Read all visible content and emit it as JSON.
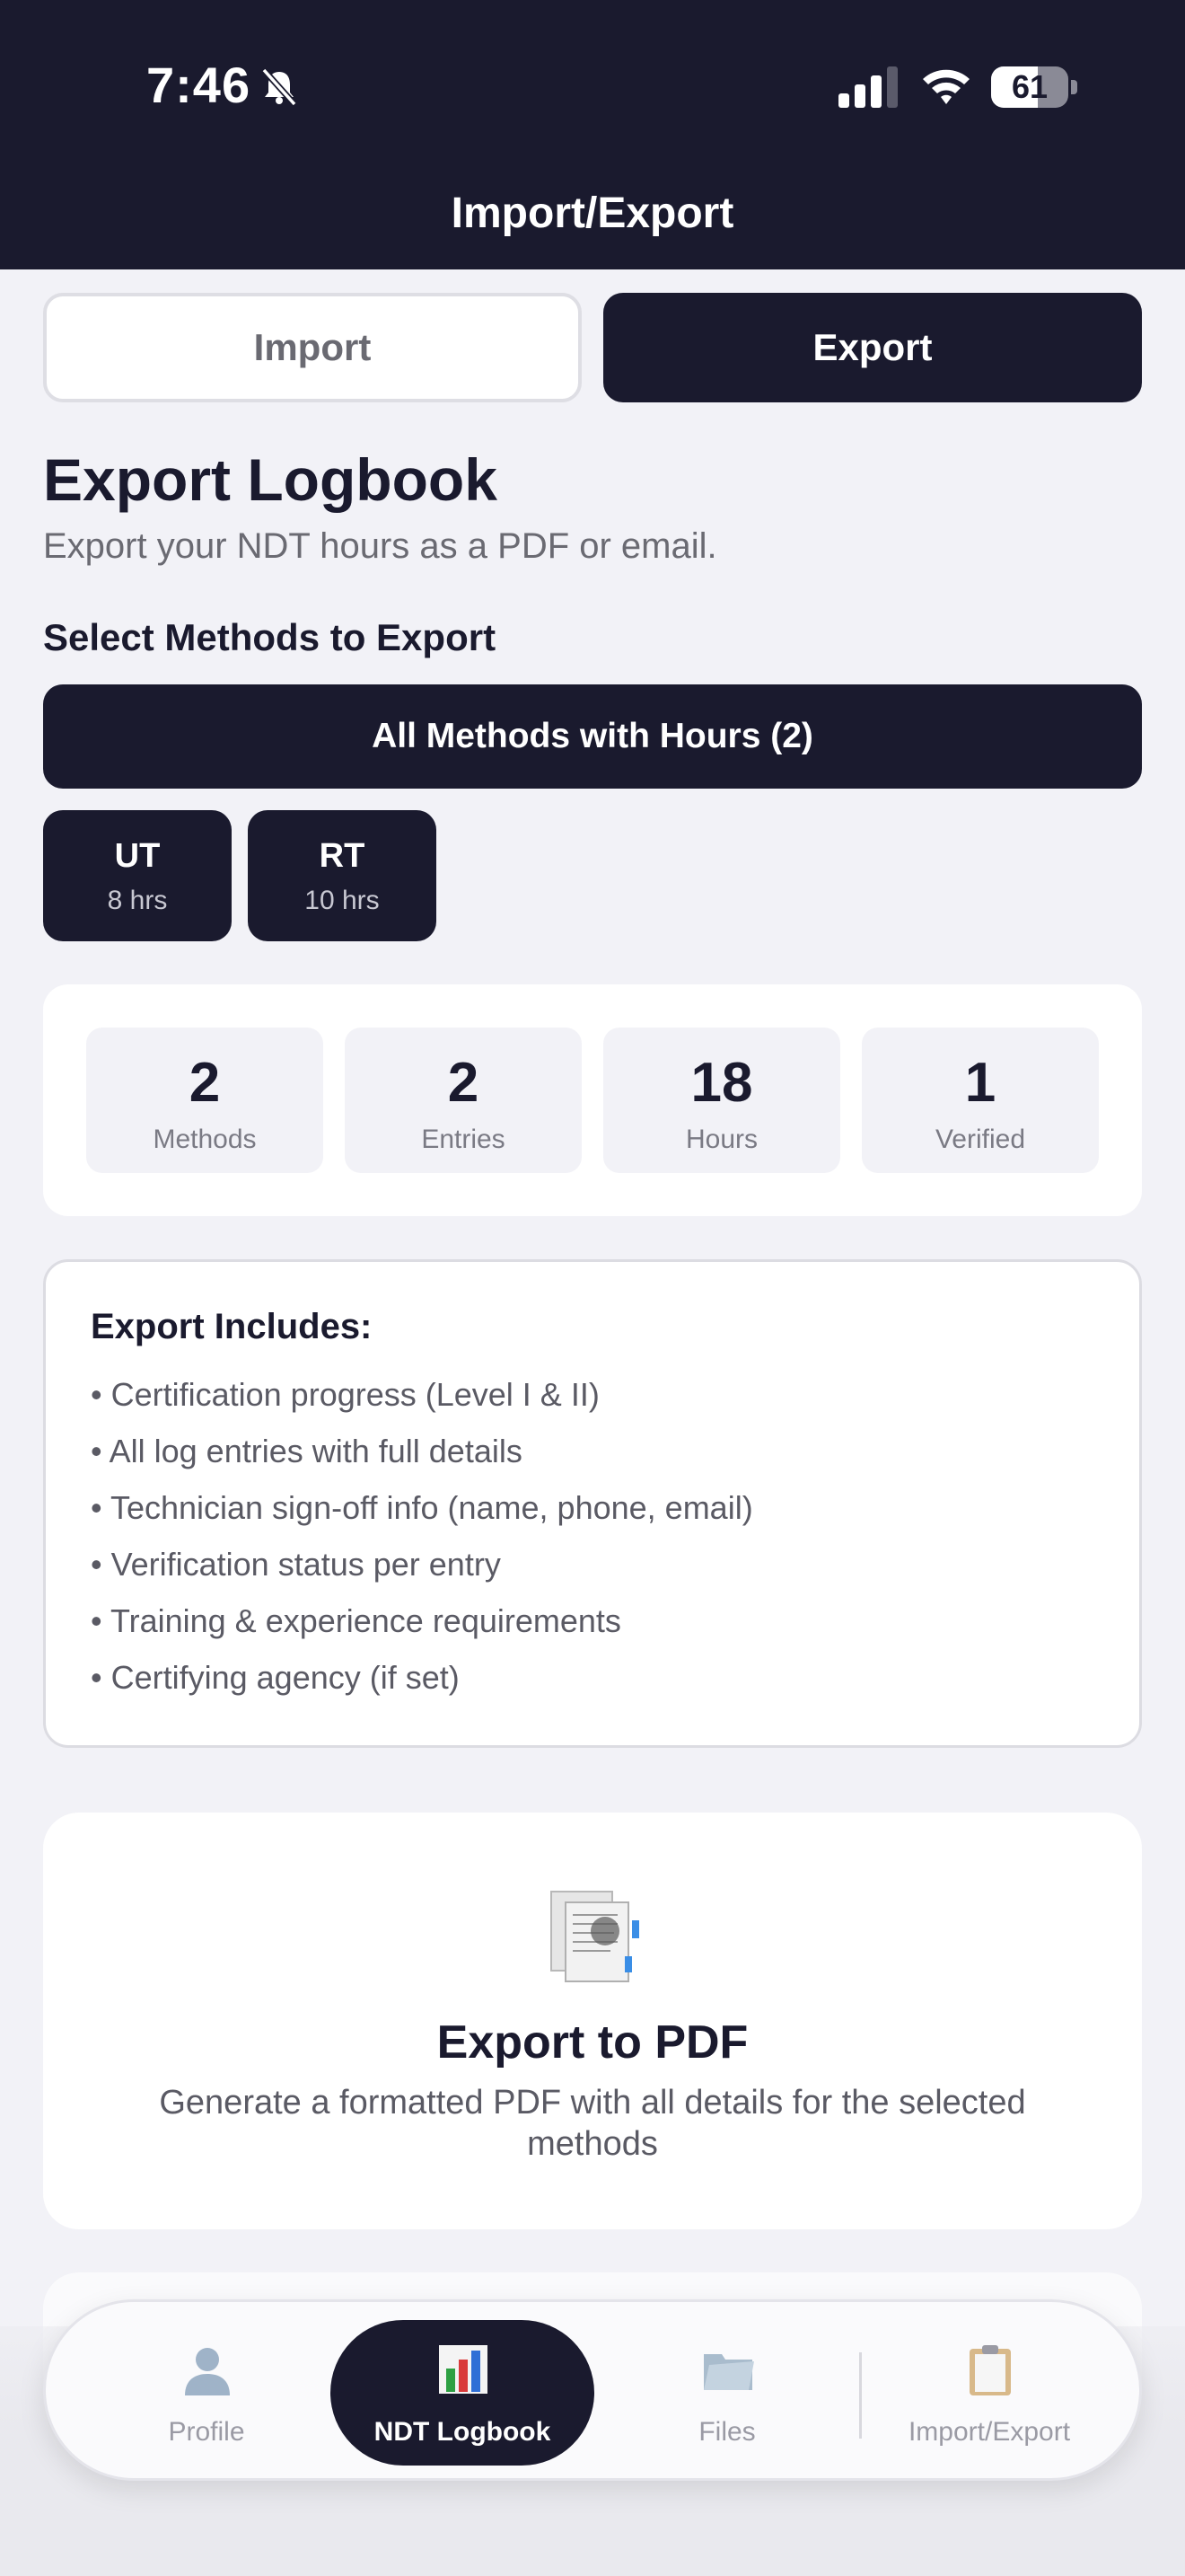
{
  "status_bar": {
    "time": "7:46",
    "battery": "61",
    "battery_level": 0.61
  },
  "header": {
    "title": "Import/Export"
  },
  "segments": {
    "import_label": "Import",
    "export_label": "Export",
    "selected": "Export"
  },
  "export": {
    "title": "Export Logbook",
    "subtitle": "Export your NDT hours as a PDF or email.",
    "select_heading": "Select Methods to Export",
    "all_methods_label": "All Methods with Hours (2)",
    "methods": [
      {
        "name": "UT",
        "hours": "8 hrs"
      },
      {
        "name": "RT",
        "hours": "10 hrs"
      }
    ]
  },
  "stats": [
    {
      "value": "2",
      "label": "Methods"
    },
    {
      "value": "2",
      "label": "Entries"
    },
    {
      "value": "18",
      "label": "Hours"
    },
    {
      "value": "1",
      "label": "Verified"
    }
  ],
  "includes": {
    "title": "Export Includes:",
    "items": [
      "• Certification progress (Level I & II)",
      "• All log entries with full details",
      "• Technician sign-off info (name, phone, email)",
      "• Verification status per entry",
      "• Training & experience requirements",
      "• Certifying agency (if set)"
    ]
  },
  "pdf_export": {
    "title": "Export to PDF",
    "description": "Generate a formatted PDF with all details for the selected methods",
    "icon": "document-icon"
  },
  "tabs": [
    {
      "label": "Profile",
      "icon": "person-icon"
    },
    {
      "label": "NDT Logbook",
      "icon": "bar-chart-icon",
      "active": true
    },
    {
      "label": "Files",
      "icon": "folder-icon"
    },
    {
      "label": "Import/Export",
      "icon": "clipboard-icon"
    }
  ],
  "colors": {
    "primary": "#1a1a2e",
    "background": "#f2f2f7",
    "card": "#ffffff"
  }
}
